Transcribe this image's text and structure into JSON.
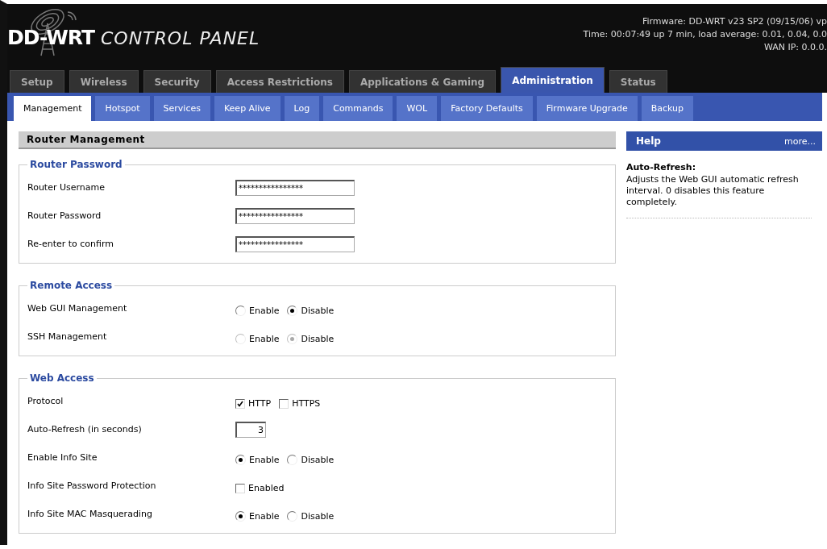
{
  "header": {
    "logo": {
      "brand": "DD-WRT",
      "subtitle": "CONTROL PANEL"
    },
    "status_lines": [
      "Firmware: DD-WRT v23 SP2 (09/15/06) vp",
      "Time: 00:07:49 up 7 min, load average: 0.01, 0.04, 0.0",
      "WAN IP: 0.0.0."
    ]
  },
  "tabs": [
    {
      "label": "Setup",
      "selected": false
    },
    {
      "label": "Wireless",
      "selected": false
    },
    {
      "label": "Security",
      "selected": false
    },
    {
      "label": "Access Restrictions",
      "selected": false
    },
    {
      "label": "Applications & Gaming",
      "selected": false
    },
    {
      "label": "Administration",
      "selected": true
    },
    {
      "label": "Status",
      "selected": false
    }
  ],
  "subtabs": [
    {
      "label": "Management",
      "selected": true
    },
    {
      "label": "Hotspot",
      "selected": false
    },
    {
      "label": "Services",
      "selected": false
    },
    {
      "label": "Keep Alive",
      "selected": false
    },
    {
      "label": "Log",
      "selected": false
    },
    {
      "label": "Commands",
      "selected": false
    },
    {
      "label": "WOL",
      "selected": false
    },
    {
      "label": "Factory Defaults",
      "selected": false
    },
    {
      "label": "Firmware Upgrade",
      "selected": false
    },
    {
      "label": "Backup",
      "selected": false
    }
  ],
  "main": {
    "title": "Router Management",
    "sections": [
      {
        "legend": "Router Password",
        "rows": [
          {
            "kind": "password",
            "label": "Router Username",
            "value": "****************"
          },
          {
            "kind": "password",
            "label": "Router Password",
            "value": "****************"
          },
          {
            "kind": "password",
            "label": "Re-enter to confirm",
            "value": "****************"
          }
        ]
      },
      {
        "legend": "Remote Access",
        "rows": [
          {
            "kind": "radio",
            "label": "Web GUI Management",
            "disabled": false,
            "options": [
              {
                "label": "Enable",
                "selected": false
              },
              {
                "label": "Disable",
                "selected": true
              }
            ]
          },
          {
            "kind": "radio",
            "label": "SSH Management",
            "disabled": true,
            "options": [
              {
                "label": "Enable",
                "selected": false
              },
              {
                "label": "Disable",
                "selected": true
              }
            ]
          }
        ]
      },
      {
        "legend": "Web Access",
        "rows": [
          {
            "kind": "checkbox",
            "label": "Protocol",
            "options": [
              {
                "label": "HTTP",
                "checked": true
              },
              {
                "label": "HTTPS",
                "checked": false
              }
            ]
          },
          {
            "kind": "number",
            "label": "Auto-Refresh (in seconds)",
            "value": "3"
          },
          {
            "kind": "radio",
            "label": "Enable Info Site",
            "disabled": false,
            "options": [
              {
                "label": "Enable",
                "selected": true
              },
              {
                "label": "Disable",
                "selected": false
              }
            ]
          },
          {
            "kind": "checkbox",
            "label": "Info Site Password Protection",
            "options": [
              {
                "label": "Enabled",
                "checked": false
              }
            ]
          },
          {
            "kind": "radio",
            "label": "Info Site MAC Masquerading",
            "disabled": false,
            "options": [
              {
                "label": "Enable",
                "selected": true
              },
              {
                "label": "Disable",
                "selected": false
              }
            ]
          }
        ]
      }
    ]
  },
  "help": {
    "title": "Help",
    "more": "more...",
    "topic": "Auto-Refresh:",
    "text": "Adjusts the Web GUI automatic refresh interval. 0 disables this feature completely."
  }
}
